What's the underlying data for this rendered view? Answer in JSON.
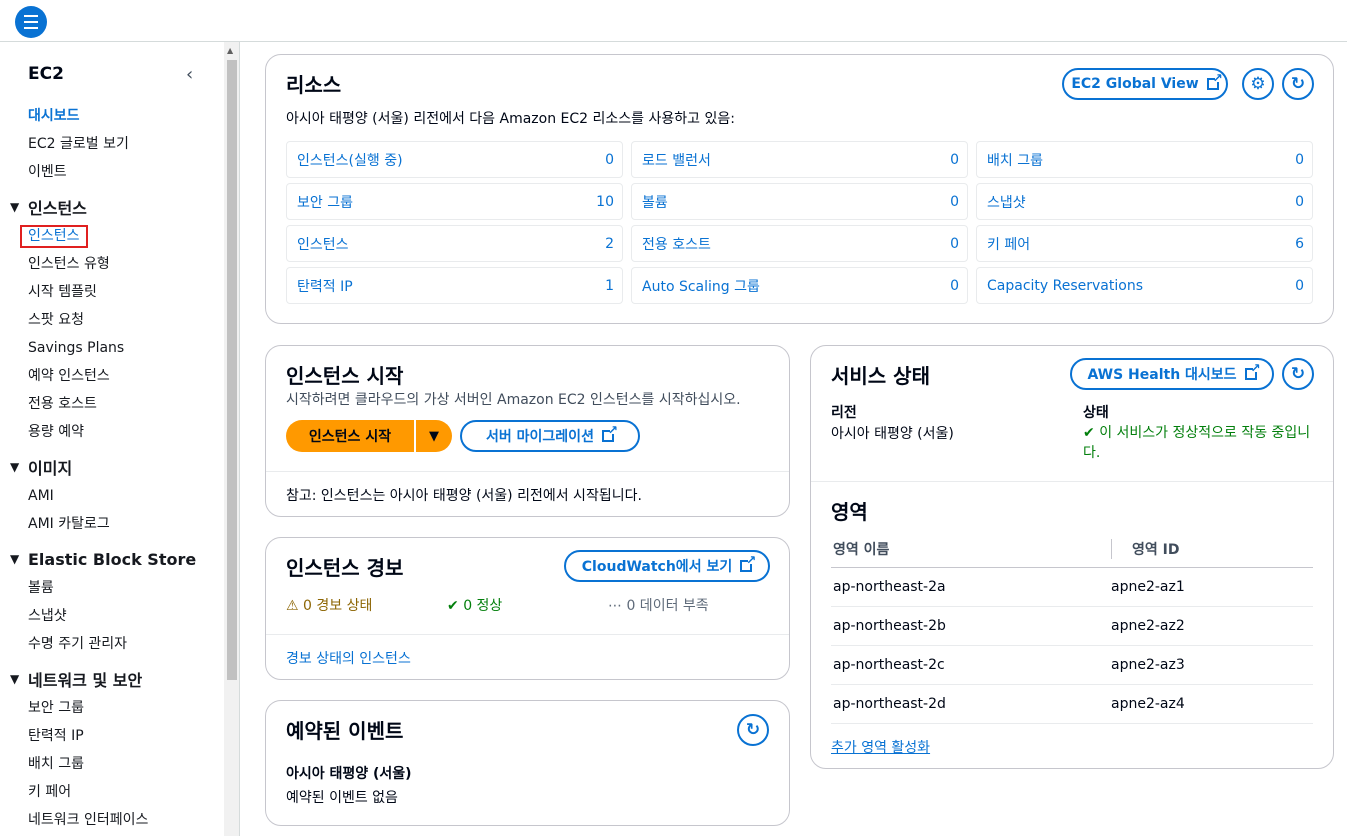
{
  "sidebar": {
    "title": "EC2",
    "top_items": [
      "대시보드",
      "EC2 글로벌 보기",
      "이벤트"
    ],
    "sections": [
      {
        "label": "인스턴스",
        "items": [
          "인스턴스",
          "인스턴스 유형",
          "시작 템플릿",
          "스팟 요청",
          "Savings Plans",
          "예약 인스턴스",
          "전용 호스트",
          "용량 예약"
        ]
      },
      {
        "label": "이미지",
        "items": [
          "AMI",
          "AMI 카탈로그"
        ]
      },
      {
        "label": "Elastic Block Store",
        "items": [
          "볼륨",
          "스냅샷",
          "수명 주기 관리자"
        ]
      },
      {
        "label": "네트워크 및 보안",
        "items": [
          "보안 그룹",
          "탄력적 IP",
          "배치 그룹",
          "키 페어",
          "네트워크 인터페이스"
        ]
      }
    ]
  },
  "resources": {
    "title": "리소스",
    "global_view_btn": "EC2 Global View",
    "description": "아시아 태평양 (서울) 리전에서 다음 Amazon EC2 리소스를 사용하고 있음:",
    "cells": [
      {
        "label": "인스턴스(실행 중)",
        "value": "0"
      },
      {
        "label": "로드 밸런서",
        "value": "0"
      },
      {
        "label": "배치 그룹",
        "value": "0"
      },
      {
        "label": "보안 그룹",
        "value": "10"
      },
      {
        "label": "볼륨",
        "value": "0"
      },
      {
        "label": "스냅샷",
        "value": "0"
      },
      {
        "label": "인스턴스",
        "value": "2"
      },
      {
        "label": "전용 호스트",
        "value": "0"
      },
      {
        "label": "키 페어",
        "value": "6"
      },
      {
        "label": "탄력적 IP",
        "value": "1"
      },
      {
        "label": "Auto Scaling 그룹",
        "value": "0"
      },
      {
        "label": "Capacity Reservations",
        "value": "0"
      }
    ]
  },
  "launch": {
    "title": "인스턴스 시작",
    "description": "시작하려면 클라우드의 가상 서버인 Amazon EC2 인스턴스를 시작하십시오.",
    "launch_btn": "인스턴스 시작",
    "migrate_btn": "서버 마이그레이션",
    "note": "참고: 인스턴스는 아시아 태평양 (서울) 리전에서 시작됩니다."
  },
  "alarms": {
    "title": "인스턴스 경보",
    "cloudwatch_btn": "CloudWatch에서 보기",
    "alarm_state": "0 경보 상태",
    "ok_state": "0 정상",
    "insufficient": "0 데이터 부족",
    "link": "경보 상태의 인스턴스"
  },
  "events": {
    "title": "예약된 이벤트",
    "region": "아시아 태평양 (서울)",
    "none": "예약된 이벤트 없음"
  },
  "service": {
    "title": "서비스 상태",
    "health_btn": "AWS Health 대시보드",
    "region_label": "리전",
    "region_value": "아시아 태평양 (서울)",
    "status_label": "상태",
    "status_value": "이 서비스가 정상적으로 작동 중입니다.",
    "zones_title": "영역",
    "col_name": "영역 이름",
    "col_id": "영역 ID",
    "zones": [
      {
        "name": "ap-northeast-2a",
        "id": "apne2-az1"
      },
      {
        "name": "ap-northeast-2b",
        "id": "apne2-az2"
      },
      {
        "name": "ap-northeast-2c",
        "id": "apne2-az3"
      },
      {
        "name": "ap-northeast-2d",
        "id": "apne2-az4"
      }
    ],
    "enable_zones": "추가 영역 활성화"
  }
}
